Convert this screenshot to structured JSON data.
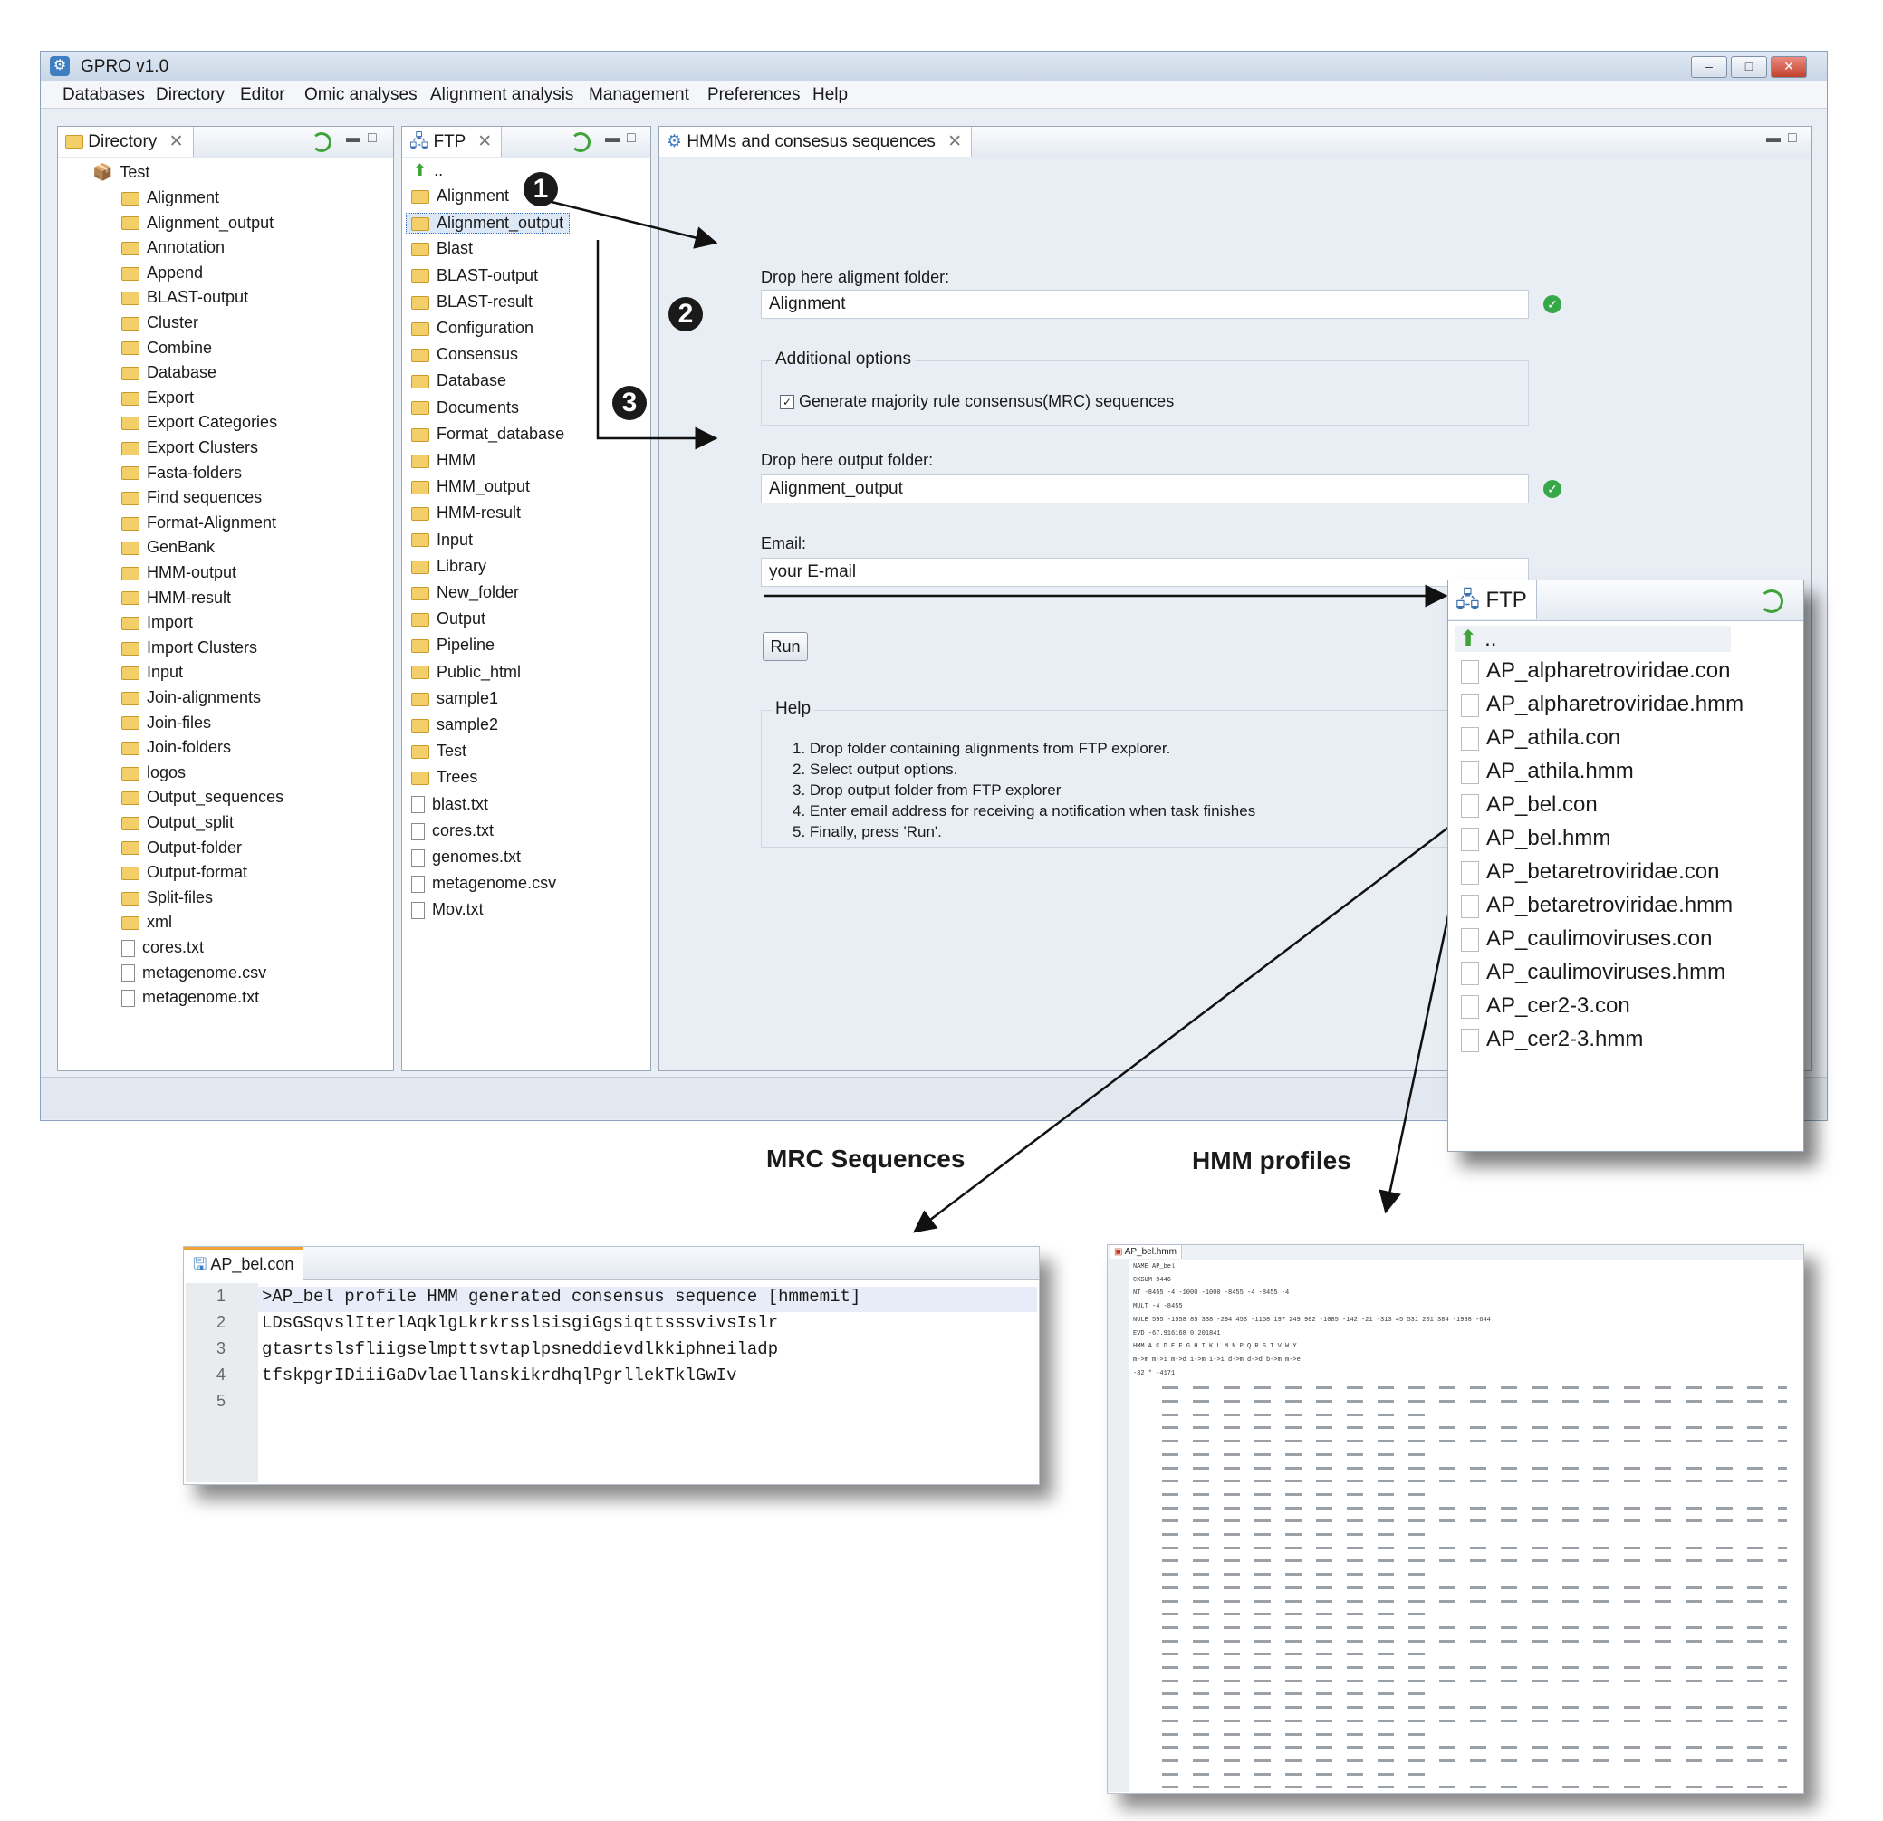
{
  "window": {
    "title": "GPRO v1.0",
    "buttons": {
      "minimize": "–",
      "maximize": "□",
      "close": "✕"
    }
  },
  "menu": [
    "Databases",
    "Directory",
    "Editor",
    "Omic analyses",
    "Alignment analysis",
    "Management",
    "Preferences",
    "Help"
  ],
  "directory_panel": {
    "tab": "Directory",
    "root": "Test",
    "folders": [
      "Alignment",
      "Alignment_output",
      "Annotation",
      "Append",
      "BLAST-output",
      "Cluster",
      "Combine",
      "Database",
      "Export",
      "Export Categories",
      "Export Clusters",
      "Fasta-folders",
      "Find sequences",
      "Format-Alignment",
      "GenBank",
      "HMM-output",
      "HMM-result",
      "Import",
      "Import Clusters",
      "Input",
      "Join-alignments",
      "Join-files",
      "Join-folders",
      "logos",
      "Output_sequences",
      "Output_split",
      "Output-folder",
      "Output-format",
      "Split-files",
      "xml"
    ],
    "files": [
      "cores.txt",
      "metagenome.csv",
      "metagenome.txt"
    ]
  },
  "ftp_panel": {
    "tab": "FTP",
    "up": "..",
    "folders": [
      "Alignment",
      "Alignment_output",
      "Blast",
      "BLAST-output",
      "BLAST-result",
      "Configuration",
      "Consensus",
      "Database",
      "Documents",
      "Format_database",
      "HMM",
      "HMM_output",
      "HMM-result",
      "Input",
      "Library",
      "New_folder",
      "Output",
      "Pipeline",
      "Public_html",
      "sample1",
      "sample2",
      "Test",
      "Trees"
    ],
    "files": [
      "blast.txt",
      "cores.txt",
      "genomes.txt",
      "metagenome.csv",
      "Mov.txt"
    ]
  },
  "hmm_panel": {
    "tab": "HMMs and consesus sequences",
    "alignment_label": "Drop here aligment folder:",
    "alignment_value": "Alignment",
    "options_legend": "Additional options",
    "mrc_checkbox": "Generate majority rule consensus(MRC) sequences",
    "output_label": "Drop here output folder:",
    "output_value": "Alignment_output",
    "email_label": "Email:",
    "email_value": "your E-mail",
    "run": "Run",
    "help_legend": "Help",
    "help": [
      "1. Drop folder containing alignments from FTP explorer.",
      "2. Select output options.",
      "3. Drop output folder from FTP explorer",
      "4. Enter email address for receiving a notification when task finishes",
      "5. Finally, press 'Run'."
    ]
  },
  "steps": [
    "1",
    "2",
    "3"
  ],
  "ftp_zoom": {
    "tab": "FTP",
    "up": "..",
    "files": [
      "AP_alpharetroviridae.con",
      "AP_alpharetroviridae.hmm",
      "AP_athila.con",
      "AP_athila.hmm",
      "AP_bel.con",
      "AP_bel.hmm",
      "AP_betaretroviridae.con",
      "AP_betaretroviridae.hmm",
      "AP_caulimoviruses.con",
      "AP_caulimoviruses.hmm",
      "AP_cer2-3.con",
      "AP_cer2-3.hmm"
    ]
  },
  "captions": {
    "mrc": "MRC Sequences",
    "hmm": "HMM profiles"
  },
  "mrc_editor": {
    "tab": "AP_bel.con",
    "line_numbers": [
      "1",
      "2",
      "3",
      "4",
      "5"
    ],
    "lines": [
      ">AP_bel profile HMM generated consensus sequence [hmmemit]",
      "LDsGSqvslIterlAqklgLkrkrsslsisgiGgsiqttsssvivsIslr",
      "gtasrtslsfliigselmpttsvtaplpsneddievdlkkiphneiladp",
      "tfskpgrIDiiiGaDvlaellanskikrdhqlPgrllekTklGwIv",
      ""
    ]
  },
  "hmm_editor": {
    "tab": "AP_bel.hmm",
    "header": [
      "NAME  AP_bel",
      "CKSUM 9446",
      "NT    -8455    -4  -1000  -1000  -8455     -4  -8455     -4",
      "MULT    -4  -8455",
      "NULE   595  -1558     85    338   -294    453  -1158    197    249    902  -1085   -142    -21   -313     45    531    201    384  -1998   -644",
      "EVD  -67.916168   0.201841",
      "HMM      A      C      D      E      F      G      H      I      K      L      M      N      P      Q      R      S      T      V      W      Y",
      "       m->m   m->i   m->d   i->m   i->i   d->m   d->d   b->m   m->e",
      "        -82      *  -4171"
    ]
  }
}
